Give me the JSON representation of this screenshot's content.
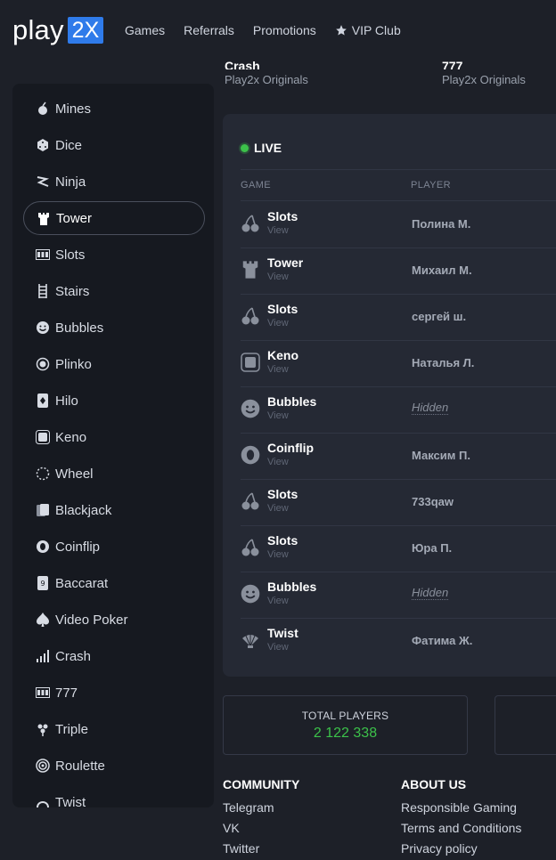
{
  "header": {
    "logo_text": "play",
    "logo_badge": "2X",
    "nav": [
      "Games",
      "Referrals",
      "Promotions"
    ],
    "vip_label": "VIP Club"
  },
  "top_cards": [
    {
      "title": "Crash",
      "subtitle": "Play2x Originals"
    },
    {
      "title": "777",
      "subtitle": "Play2x Originals"
    }
  ],
  "sidebar": {
    "active": "Tower",
    "items": [
      {
        "label": "Mines",
        "icon": "mines-icon"
      },
      {
        "label": "Dice",
        "icon": "dice-icon"
      },
      {
        "label": "Ninja",
        "icon": "ninja-icon"
      },
      {
        "label": "Tower",
        "icon": "tower-icon"
      },
      {
        "label": "Slots",
        "icon": "slots-icon"
      },
      {
        "label": "Stairs",
        "icon": "stairs-icon"
      },
      {
        "label": "Bubbles",
        "icon": "bubbles-icon"
      },
      {
        "label": "Plinko",
        "icon": "plinko-icon"
      },
      {
        "label": "Hilo",
        "icon": "hilo-icon"
      },
      {
        "label": "Keno",
        "icon": "keno-icon"
      },
      {
        "label": "Wheel",
        "icon": "wheel-icon"
      },
      {
        "label": "Blackjack",
        "icon": "blackjack-icon"
      },
      {
        "label": "Coinflip",
        "icon": "coinflip-icon"
      },
      {
        "label": "Baccarat",
        "icon": "baccarat-icon"
      },
      {
        "label": "Video Poker",
        "icon": "video-poker-icon"
      },
      {
        "label": "Crash",
        "icon": "crash-icon"
      },
      {
        "label": "777",
        "icon": "777-icon"
      },
      {
        "label": "Triple",
        "icon": "triple-icon"
      },
      {
        "label": "Roulette",
        "icon": "roulette-icon"
      },
      {
        "label": "Twist",
        "icon": "twist-icon"
      }
    ]
  },
  "live": {
    "title": "LIVE",
    "col_game": "GAME",
    "col_player": "PLAYER",
    "view_label": "View",
    "rows": [
      {
        "game": "Slots",
        "icon": "cherry-icon",
        "player": "Полина М.",
        "hidden": false
      },
      {
        "game": "Tower",
        "icon": "tower-icon",
        "player": "Михаил М.",
        "hidden": false
      },
      {
        "game": "Slots",
        "icon": "cherry-icon",
        "player": "сергей ш.",
        "hidden": false
      },
      {
        "game": "Keno",
        "icon": "keno-icon",
        "player": "Наталья Л.",
        "hidden": false
      },
      {
        "game": "Bubbles",
        "icon": "smiley-icon",
        "player": "Hidden",
        "hidden": true
      },
      {
        "game": "Coinflip",
        "icon": "coin-icon",
        "player": "Максим П.",
        "hidden": false
      },
      {
        "game": "Slots",
        "icon": "cherry-icon",
        "player": "733qaw",
        "hidden": false
      },
      {
        "game": "Slots",
        "icon": "cherry-icon",
        "player": "Юра П.",
        "hidden": false
      },
      {
        "game": "Bubbles",
        "icon": "smiley-icon",
        "player": "Hidden",
        "hidden": true
      },
      {
        "game": "Twist",
        "icon": "shell-icon",
        "player": "Фатима Ж.",
        "hidden": false
      }
    ]
  },
  "stats": {
    "total_players_label": "TOTAL PLAYERS",
    "total_players_value": "2 122 338"
  },
  "footer": {
    "community": {
      "title": "COMMUNITY",
      "links": [
        "Telegram",
        "VK",
        "Twitter"
      ]
    },
    "about": {
      "title": "ABOUT US",
      "links": [
        "Responsible Gaming",
        "Terms and Conditions",
        "Privacy policy"
      ]
    }
  },
  "colors": {
    "accent": "#2f7bea",
    "live_green": "#3cc14a"
  }
}
